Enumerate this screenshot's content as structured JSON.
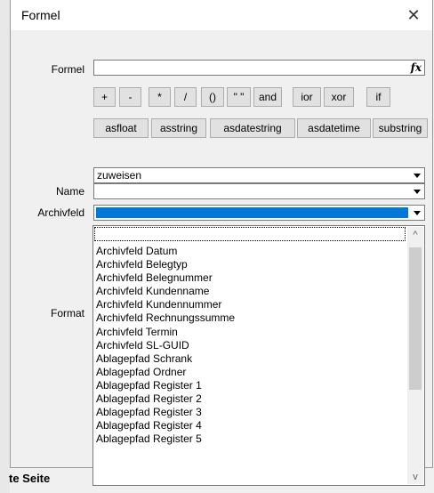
{
  "dialog": {
    "title": "Formel"
  },
  "labels": {
    "formel": "Formel",
    "name": "Name",
    "archivfeld": "Archivfeld",
    "format": "Format"
  },
  "formel": {
    "value": ""
  },
  "operators": [
    "+",
    "-",
    "*",
    "/",
    "()",
    "\" \"",
    "and",
    "ior",
    "xor",
    "if"
  ],
  "functions": [
    "asfloat",
    "asstring",
    "asdatestring",
    "asdatetime",
    "substring"
  ],
  "combos": {
    "zuweisen": "zuweisen",
    "name": "",
    "archivfeld": ""
  },
  "dropdown": {
    "items": [
      "Archivfeld Datum",
      "Archivfeld Belegtyp",
      "Archivfeld Belegnummer",
      "Archivfeld Kundenname",
      "Archivfeld Kundennummer",
      "Archivfeld Rechnungssumme",
      "Archivfeld Termin",
      "Archivfeld SL-GUID",
      "Ablagepfad Schrank",
      "Ablagepfad Ordner",
      "Ablagepfad Register  1",
      "Ablagepfad Register  2",
      "Ablagepfad Register  3",
      "Ablagepfad Register  4",
      "Ablagepfad Register  5"
    ]
  },
  "background": {
    "bottom_label": "te Seite"
  },
  "colors": {
    "selection": "#0078d7",
    "dialog_bg": "#f0f0f0"
  }
}
